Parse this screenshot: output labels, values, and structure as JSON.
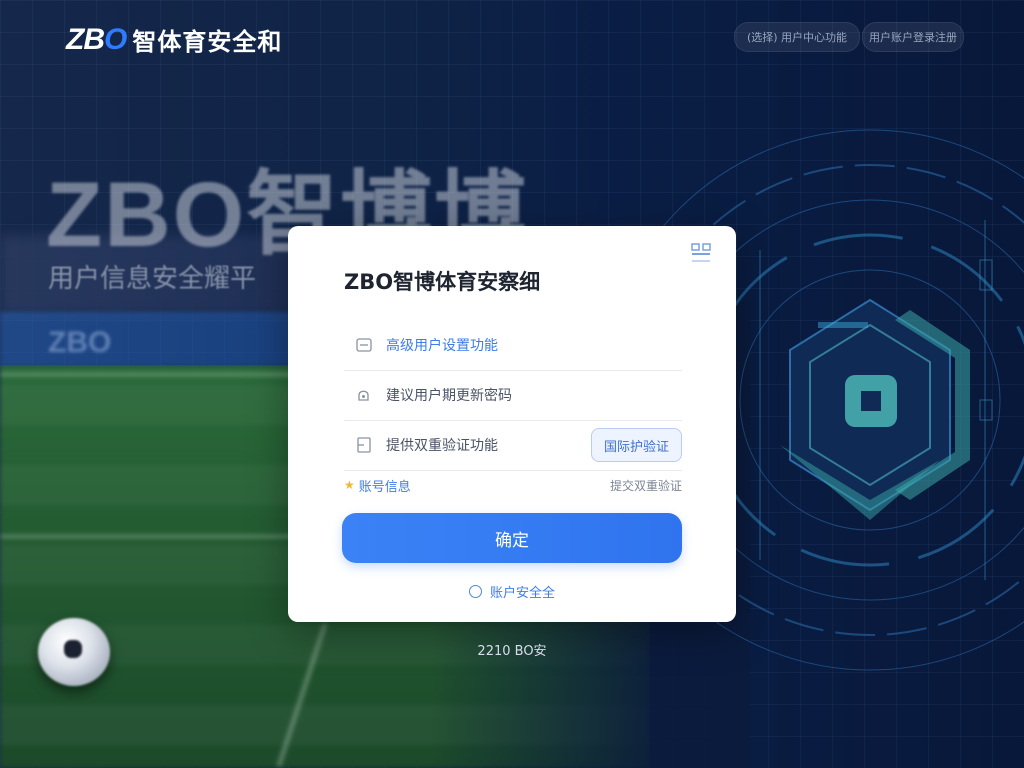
{
  "header": {
    "logo_mark_prefix": "ZB",
    "logo_mark_o": "O",
    "logo_name": "智体育安全和",
    "pill_left": "(选择) 用户中心功能",
    "pill_right": "用户账户登录注册"
  },
  "background": {
    "hero_title": "ZBO智博博",
    "hero_subtitle": "用户信息安全耀平",
    "banner_text": "ZBO"
  },
  "login_card": {
    "title": "ZBO智博体育安察细",
    "fields": [
      {
        "icon": "id-card-icon",
        "text": "高级用户设置功能"
      },
      {
        "icon": "lock-icon",
        "text": "建议用户期更新密码"
      },
      {
        "icon": "message-icon",
        "text": "提供双重验证功能"
      }
    ],
    "sms_button": "国际护验证",
    "account_info_link": "账号信息",
    "verify_link": "提交双重验证",
    "submit_label": "确定",
    "safe_label": "账户安全全"
  },
  "footer": {
    "text": "2210 BO安"
  },
  "colors": {
    "accent": "#3b82f6",
    "card_bg": "#ffffff",
    "page_bg": "#0b1b3d"
  }
}
